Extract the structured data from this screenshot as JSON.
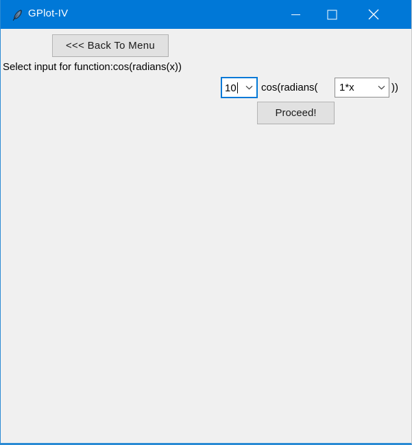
{
  "window": {
    "title": "GPlot-IV",
    "icon": "feather-icon",
    "accent_color": "#0078d7",
    "body_color": "#f0f0f0",
    "controls": {
      "minimize": "minimize-icon",
      "maximize": "maximize-icon",
      "close": "close-icon"
    }
  },
  "main": {
    "back_button_label": "<<< Back To Menu",
    "prompt_label": "Select input for function:cos(radians(x))",
    "expression": {
      "prefix_label": "cos(radians(",
      "suffix_label": "))",
      "input_count": {
        "value": "10",
        "focused": true,
        "arrow": "chevron-down-icon"
      },
      "inner_expression": {
        "value": "1*x",
        "focused": false,
        "arrow": "chevron-down-icon"
      }
    },
    "proceed_button_label": "Proceed!"
  }
}
